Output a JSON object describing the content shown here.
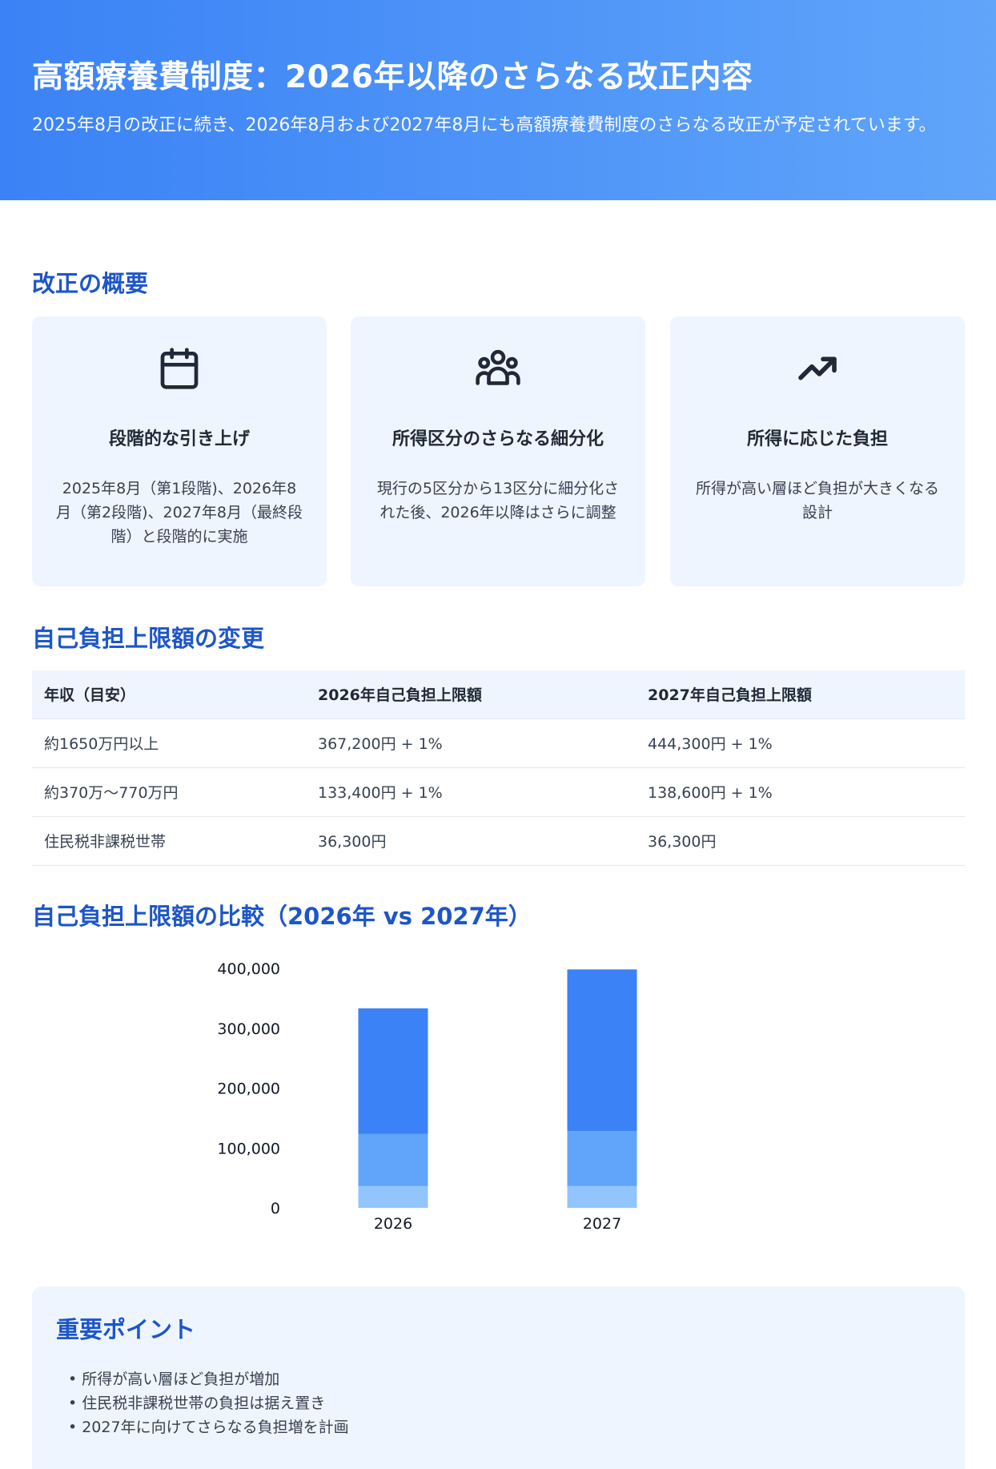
{
  "header": {
    "title": "高額療養費制度：2026年以降のさらなる改正内容",
    "subtitle": "2025年8月の改正に続き、2026年8月および2027年8月にも高額療養費制度のさらなる改正が予定されています。"
  },
  "overview": {
    "title": "改正の概要",
    "cards": [
      {
        "icon": "calendar-icon",
        "title": "段階的な引き上げ",
        "text": "2025年8月（第1段階)、2026年8月（第2段階)、2027年8月（最終段階）と段階的に実施"
      },
      {
        "icon": "users-icon",
        "title": "所得区分のさらなる細分化",
        "text": "現行の5区分から13区分に細分化された後、2026年以降はさらに調整"
      },
      {
        "icon": "trending-up-icon",
        "title": "所得に応じた負担",
        "text": "所得が高い層ほど負担が大きくなる設計"
      }
    ]
  },
  "limits": {
    "title": "自己負担上限額の変更",
    "headers": [
      "年収（目安）",
      "2026年自己負担上限額",
      "2027年自己負担上限額"
    ],
    "rows": [
      [
        "約1650万円以上",
        "367,200円 + 1%",
        "444,300円 + 1%"
      ],
      [
        "約370万～770万円",
        "133,400円 + 1%",
        "138,600円 + 1%"
      ],
      [
        "住民税非課税世帯",
        "36,300円",
        "36,300円"
      ]
    ]
  },
  "comparison": {
    "title": "自己負担上限額の比較（2026年 vs 2027年）"
  },
  "chart_data": {
    "type": "bar",
    "stacked": true,
    "categories": [
      "2026",
      "2027"
    ],
    "series": [
      {
        "values": [
          36300,
          36300
        ],
        "color": "#93c5fd"
      },
      {
        "values": [
          87000,
          92000
        ],
        "color": "#60a5fa"
      },
      {
        "values": [
          210000,
          270000
        ],
        "color": "#3b82f6"
      }
    ],
    "yticks": [
      "0",
      "100,000",
      "200,000",
      "300,000",
      "400,000"
    ],
    "ylim": [
      0,
      400000
    ],
    "grid": false
  },
  "points": {
    "title": "重要ポイント",
    "items": [
      "所得が高い層ほど負担が増加",
      "住民税非課税世帯の負担は据え置き",
      "2027年に向けてさらなる負担増を計画"
    ]
  },
  "colors": {
    "accent": "#1d56c9",
    "card_bg": "#eff5ff",
    "hero_start": "#3b82f6",
    "hero_end": "#60a5fa"
  }
}
